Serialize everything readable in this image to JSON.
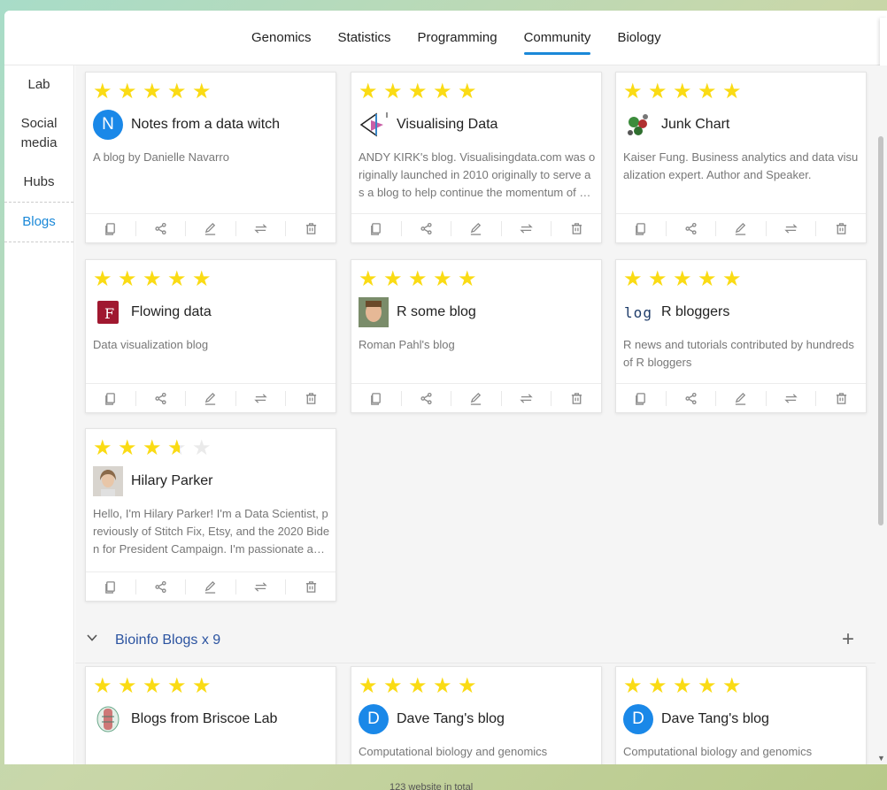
{
  "nav": {
    "tabs": [
      {
        "label": "Genomics"
      },
      {
        "label": "Statistics"
      },
      {
        "label": "Programming"
      },
      {
        "label": "Community"
      },
      {
        "label": "Biology"
      }
    ],
    "active_tab": "Community"
  },
  "sidebar": {
    "items": [
      {
        "label": "Lab"
      },
      {
        "label": "Social media"
      },
      {
        "label": "Hubs"
      },
      {
        "label": "Blogs"
      }
    ],
    "active_item": "Blogs"
  },
  "cards": [
    {
      "rating": 5,
      "avatar": "N",
      "avatar_color": "#1a88e8",
      "title": "Notes from a data witch",
      "desc": "A blog by Danielle Navarro"
    },
    {
      "rating": 5,
      "avatar_icon": "visualising-data-logo-icon",
      "title": "Visualising Data",
      "desc": "ANDY KIRK's blog. Visualisingdata.com was originally launched in 2010 originally to serve as a blog to help continue the momentum of my research"
    },
    {
      "rating": 5,
      "avatar_icon": "junk-chart-logo-icon",
      "title": "Junk Chart",
      "desc": "Kaiser Fung. Business analytics and data visualization expert. Author and Speaker."
    },
    {
      "rating": 5,
      "avatar_icon": "flowing-data-logo-icon",
      "title": "Flowing data",
      "desc": "Data visualization blog"
    },
    {
      "rating": 5,
      "avatar_icon": "roman-pahl-photo-icon",
      "title": "R some blog",
      "desc": "Roman Pahl's blog"
    },
    {
      "rating": 5,
      "avatar_text": "log",
      "avatar_icon": "r-bloggers-logo-icon",
      "title": "R bloggers",
      "desc": "R news and tutorials contributed by hundreds of R bloggers"
    },
    {
      "rating": 3.5,
      "avatar_icon": "hilary-parker-photo-icon",
      "title": "Hilary Parker",
      "desc": "Hello, I'm Hilary Parker! I'm a Data Scientist, previously of Stitch Fix, Etsy, and the 2020 Biden for President Campaign. I'm passionate about data"
    },
    {
      "rating": 5,
      "avatar_icon": "briscoe-lab-logo-icon",
      "title": "Blogs from Briscoe Lab",
      "desc": ""
    },
    {
      "rating": 5,
      "avatar": "D",
      "avatar_color": "#1a88e8",
      "title": "Dave Tang's blog",
      "desc": "Computational biology and genomics"
    },
    {
      "rating": 5,
      "avatar": "D",
      "avatar_color": "#1a88e8",
      "title": "Dave Tang's blog",
      "desc": "Computational biology and genomics"
    }
  ],
  "card_actions": [
    "copy-icon",
    "share-icon",
    "edit-icon",
    "swap-icon",
    "delete-icon"
  ],
  "section": {
    "title": "Bioinfo Blogs x 9"
  },
  "footer": {
    "text": "123 website in total"
  }
}
